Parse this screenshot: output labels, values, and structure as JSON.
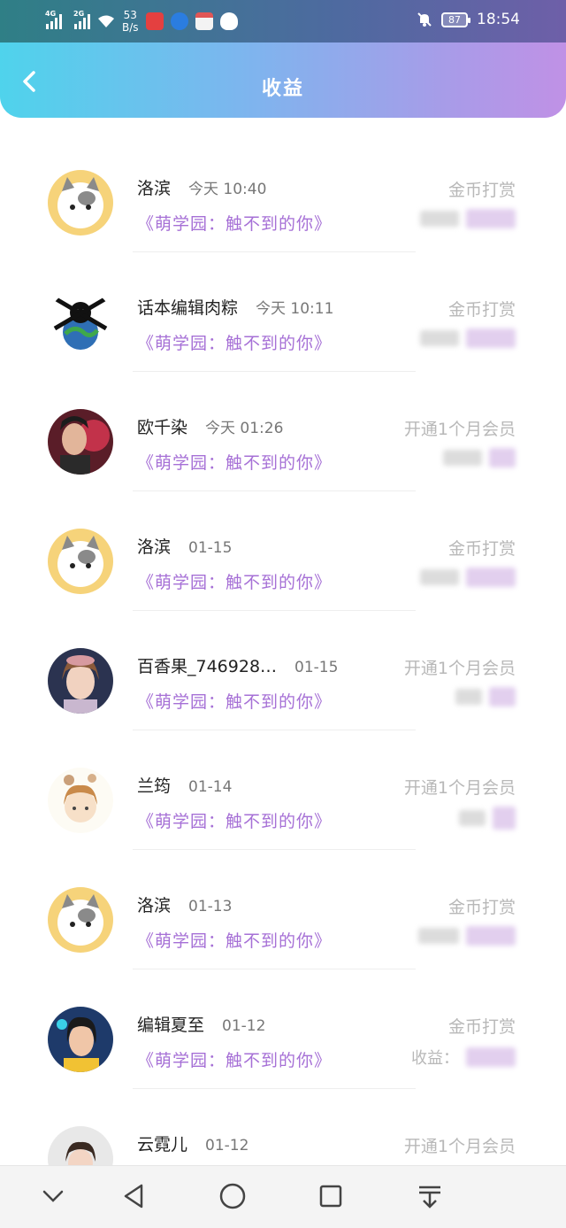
{
  "status_bar": {
    "signal1": "4G",
    "signal2": "2G",
    "net_speed_value": "53",
    "net_speed_unit": "B/s",
    "battery": "87",
    "time": "18:54"
  },
  "header": {
    "title": "收益"
  },
  "rows": [
    {
      "name": "洛滨",
      "time": "今天 10:40",
      "book": "《萌学园：触不到的你》",
      "type": "金币打赏",
      "amount_label": ""
    },
    {
      "name": "话本编辑肉粽",
      "time": "今天 10:11",
      "book": "《萌学园：触不到的你》",
      "type": "金币打赏",
      "amount_label": ""
    },
    {
      "name": "欧千染",
      "time": "今天 01:26",
      "book": "《萌学园：触不到的你》",
      "type": "开通1个月会员",
      "amount_label": ""
    },
    {
      "name": "洛滨",
      "time": "01-15",
      "book": "《萌学园：触不到的你》",
      "type": "金币打赏",
      "amount_label": ""
    },
    {
      "name": "百香果_746928…",
      "time": "01-15",
      "book": "《萌学园：触不到的你》",
      "type": "开通1个月会员",
      "amount_label": ""
    },
    {
      "name": "兰筠",
      "time": "01-14",
      "book": "《萌学园：触不到的你》",
      "type": "开通1个月会员",
      "amount_label": ""
    },
    {
      "name": "洛滨",
      "time": "01-13",
      "book": "《萌学园：触不到的你》",
      "type": "金币打赏",
      "amount_label": ""
    },
    {
      "name": "编辑夏至",
      "time": "01-12",
      "book": "《萌学园：触不到的你》",
      "type": "金币打赏",
      "amount_label": "收益："
    },
    {
      "name": "云霓儿",
      "time": "01-12",
      "book": "",
      "type": "开通1个月会员",
      "amount_label": ""
    }
  ],
  "colors": {
    "accent": "#a670d6",
    "header_start": "#4fd3ec",
    "header_end": "#c091e6"
  },
  "icons": {
    "back": "chevron-left-icon",
    "nav": [
      "chevron-down-icon",
      "back-triangle-icon",
      "home-circle-icon",
      "recents-square-icon",
      "download-icon"
    ]
  }
}
